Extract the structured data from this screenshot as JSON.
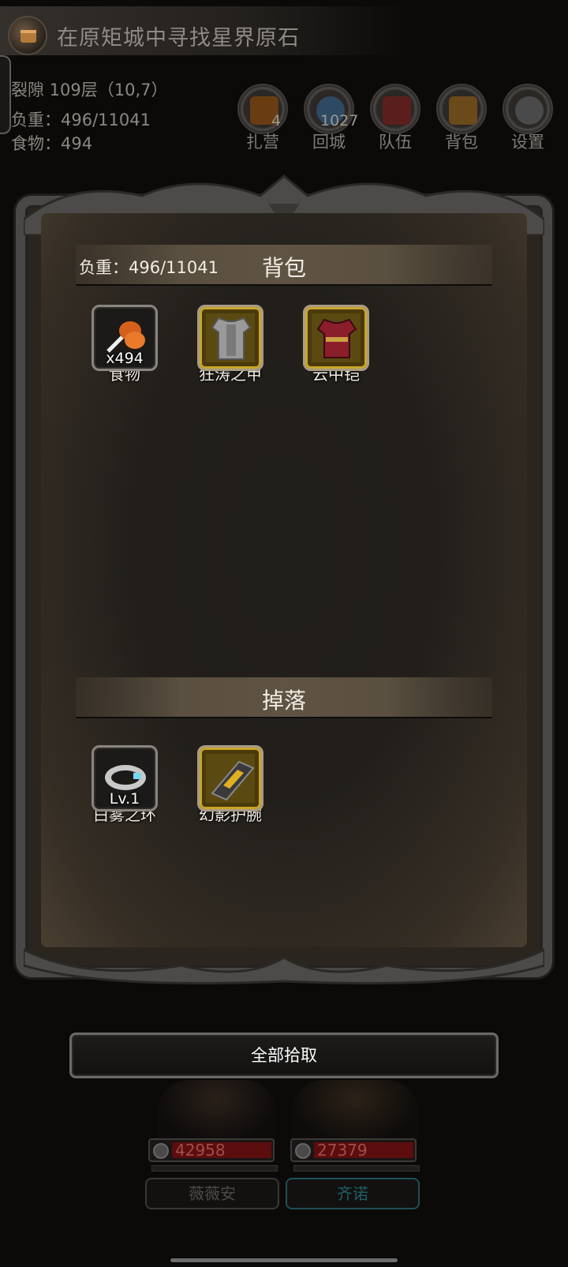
{
  "quest": {
    "text": "在原矩城中寻找星界原石"
  },
  "status": {
    "location": "裂隙 109层（10,7）",
    "load": "负重：496/11041",
    "food": "食物：494"
  },
  "top_buttons": [
    {
      "label": "扎营",
      "count": "4",
      "color": "#6a3c12"
    },
    {
      "label": "回城",
      "count": "1027",
      "color": "#2e4a63"
    },
    {
      "label": "队伍",
      "count": "",
      "color": "#5a1f1c"
    },
    {
      "label": "背包",
      "count": "",
      "color": "#6a4a1a"
    },
    {
      "label": "设置",
      "count": "",
      "color": "#4a4a4a"
    }
  ],
  "bag": {
    "title": "背包",
    "load_label": "负重：496/11041",
    "items": [
      {
        "name": "食物",
        "qty": "x494",
        "icon": "drumstick-icon"
      },
      {
        "name": "狂涛之甲",
        "qty": "",
        "icon": "plate-armor-icon"
      },
      {
        "name": "云中铠",
        "qty": "",
        "icon": "red-armor-icon"
      }
    ]
  },
  "drop": {
    "title": "掉落",
    "items": [
      {
        "name": "白雾之环",
        "qty": "Lv.1",
        "icon": "ring-icon"
      },
      {
        "name": "幻影护腕",
        "qty": "",
        "icon": "bracer-icon"
      }
    ]
  },
  "actions": {
    "pickup_all": "全部拾取"
  },
  "heroes": [
    {
      "name": "薇薇安",
      "hp": "42958",
      "active": false
    },
    {
      "name": "齐诺",
      "hp": "27379",
      "active": true
    }
  ]
}
